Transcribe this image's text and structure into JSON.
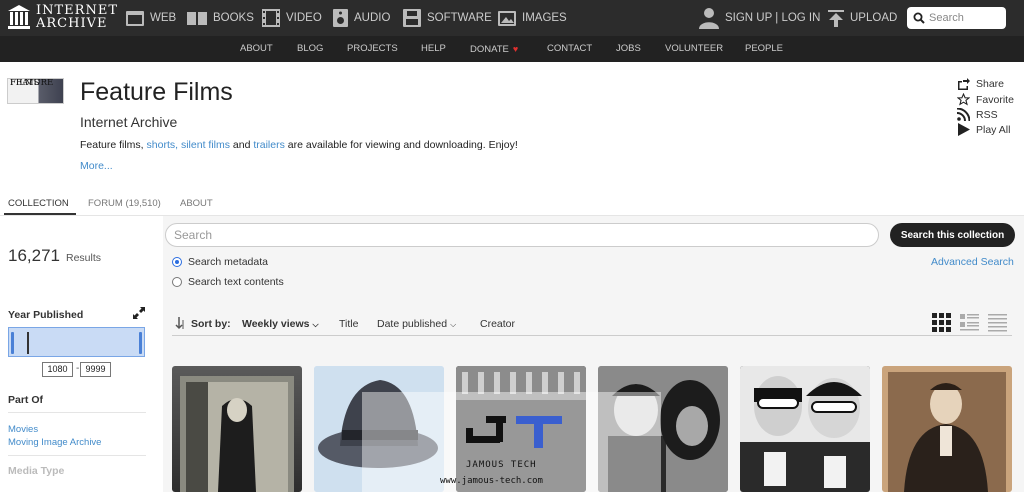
{
  "logo": {
    "line1": "INTERNET",
    "line2": "ARCHIVE"
  },
  "topnav": {
    "web": "WEB",
    "books": "BOOKS",
    "video": "VIDEO",
    "audio": "AUDIO",
    "software": "SOFTWARE",
    "images": "IMAGES",
    "signup": "SIGN UP | LOG IN",
    "upload": "UPLOAD",
    "search_placeholder": "Search"
  },
  "subnav": {
    "about": "ABOUT",
    "blog": "BLOG",
    "projects": "PROJECTS",
    "help": "HELP",
    "donate": "DONATE",
    "contact": "CONTACT",
    "jobs": "JOBS",
    "volunteer": "VOLUNTEER",
    "people": "PEOPLE"
  },
  "collection": {
    "thumb_line1": "FEATURE",
    "thumb_line2": "FILMS",
    "title": "Feature Films",
    "subtitle": "Internet Archive",
    "desc_prefix": "Feature films, ",
    "link_shorts": "shorts,",
    "link_silent": "silent films",
    "desc_and": " and ",
    "link_trailers": "trailers",
    "desc_suffix": " are available for viewing and downloading. Enjoy!",
    "more": "More..."
  },
  "actions": {
    "share": "Share",
    "favorite": "Favorite",
    "rss": "RSS",
    "play_all": "Play All"
  },
  "tabs": {
    "collection": "COLLECTION",
    "forum": "FORUM (19,510)",
    "about": "ABOUT"
  },
  "results": {
    "count": "16,271",
    "label": "Results"
  },
  "search": {
    "placeholder": "Search",
    "button": "Search this collection",
    "opt_metadata": "Search metadata",
    "opt_text": "Search text contents",
    "advanced": "Advanced Search"
  },
  "facets": {
    "year_title": "Year Published",
    "year_from": "1080",
    "year_to": "9999",
    "part_of_title": "Part Of",
    "part_of_links": [
      "Movies",
      "Moving Image Archive"
    ],
    "media_type_title": "Media Type"
  },
  "sort": {
    "label": "Sort by:",
    "weekly": "Weekly views",
    "title": "Title",
    "date_published": "Date published",
    "creator": "Creator"
  },
  "watermark": {
    "name": "JAMOUS TECH",
    "url": "www.jamous-tech.com"
  },
  "colors": {
    "topbar": "#2c2c2c",
    "subnav": "#222222",
    "link": "#428bca",
    "accent": "#2b6de0",
    "heart": "#e0302f"
  }
}
